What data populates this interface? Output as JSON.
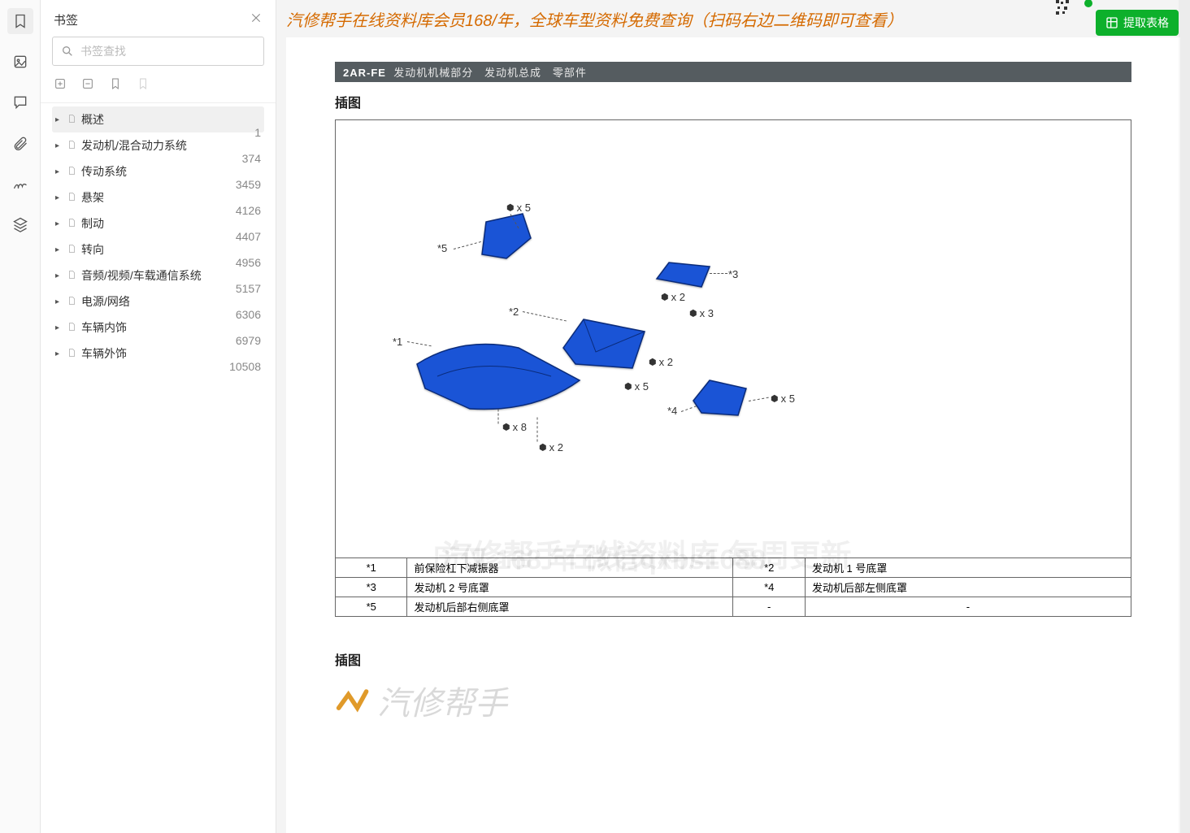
{
  "panel": {
    "title": "书签",
    "search_placeholder": "书签查找"
  },
  "tree": [
    {
      "label": "概述",
      "page": "1",
      "active": true
    },
    {
      "label": "发动机/混合动力系统",
      "page": "374"
    },
    {
      "label": "传动系统",
      "page": "3459"
    },
    {
      "label": "悬架",
      "page": "4126"
    },
    {
      "label": "制动",
      "page": "4407"
    },
    {
      "label": "转向",
      "page": "4956"
    },
    {
      "label": "音频/视频/车载通信系统",
      "page": "5157"
    },
    {
      "label": "电源/网络",
      "page": "6306"
    },
    {
      "label": "车辆内饰",
      "page": "6979"
    },
    {
      "label": "车辆外饰",
      "page": "10508"
    }
  ],
  "banner": {
    "text": "汽修帮手在线资料库会员168/年，全球车型资料免费查询（扫码右边二维码即可查看）",
    "extract_button": "提取表格"
  },
  "doc": {
    "header_engine": "2AR-FE",
    "header_sec1": "发动机机械部分",
    "header_sec2": "发动机总成",
    "header_sec3": "零部件",
    "section_title_1": "插图",
    "section_title_2": "插图",
    "callouts": {
      "c1": "*1",
      "c2": "*2",
      "c3": "*3",
      "c4": "*4",
      "c5": "*5",
      "b5a": "x 5",
      "b2a": "x 2",
      "b3a": "x 3",
      "b2b": "x 2",
      "b5b": "x 5",
      "b5c": "x 5",
      "b8": "x 8",
      "b2c": "x 2"
    },
    "table": [
      {
        "n1": "*1",
        "d1": "前保险杠下减振器",
        "n2": "*2",
        "d2": "发动机 1 号底罩"
      },
      {
        "n1": "*3",
        "d1": "发动机 2 号底罩",
        "n2": "*4",
        "d2": "发动机后部左侧底罩"
      },
      {
        "n1": "*5",
        "d1": "发动机后部右侧底罩",
        "n2": "-",
        "d2": "-"
      }
    ],
    "watermark_main": "汽修帮手在线资料库 每周更新",
    "watermark_sub": "历仅 168 年 微信qxbs1688",
    "watermark_logo": "汽修帮手"
  }
}
